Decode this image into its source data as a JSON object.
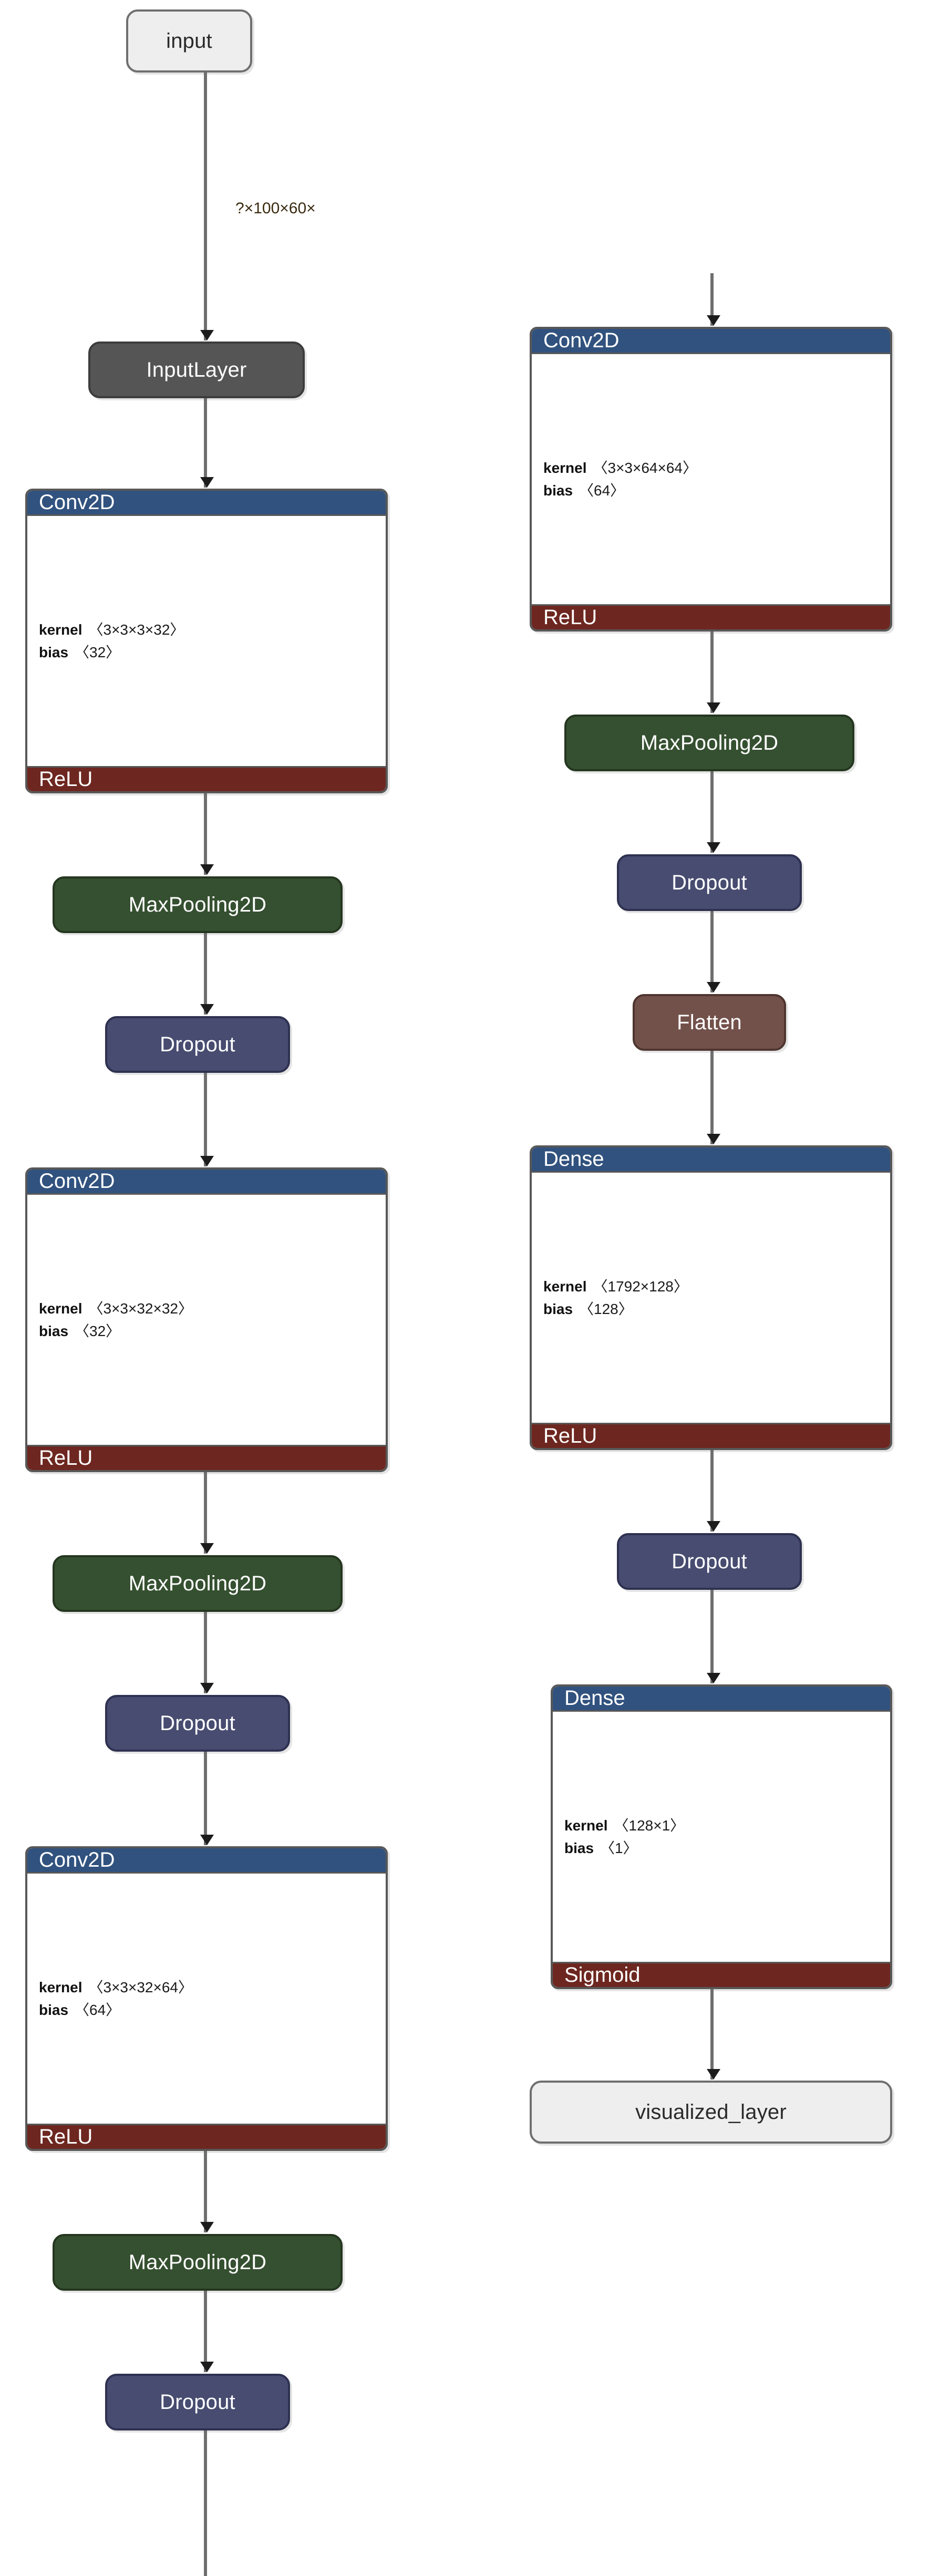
{
  "diagram": {
    "title": "visualized_layer model graph",
    "colors": {
      "layer_header": "#31527e",
      "activation": "#6d2720",
      "pooling": "#355030",
      "dropout": "#474c70",
      "flatten": "#73514b",
      "input_layer": "#555555",
      "io_node": "#eeeeee",
      "edge": "#6e6e6e",
      "border": "#4a4a4a",
      "params_bg": "#ffffff"
    }
  },
  "labels": {
    "kernel": "kernel",
    "bias": "bias"
  },
  "edge_labels": {
    "input_shape": "?×100×60×"
  },
  "nodes": {
    "input": {
      "label": "input",
      "kind": "io"
    },
    "input_layer": {
      "label": "InputLayer",
      "kind": "simple"
    },
    "conv1": {
      "title": "Conv2D",
      "kernel_shape": "〈3×3×3×32〉",
      "bias_shape": "〈32〉",
      "activation": "ReLU"
    },
    "pool1": {
      "label": "MaxPooling2D",
      "kind": "pool"
    },
    "drop1": {
      "label": "Dropout",
      "kind": "dropout"
    },
    "conv2": {
      "title": "Conv2D",
      "kernel_shape": "〈3×3×32×32〉",
      "bias_shape": "〈32〉",
      "activation": "ReLU"
    },
    "pool2": {
      "label": "MaxPooling2D",
      "kind": "pool"
    },
    "drop2": {
      "label": "Dropout",
      "kind": "dropout"
    },
    "conv3": {
      "title": "Conv2D",
      "kernel_shape": "〈3×3×32×64〉",
      "bias_shape": "〈64〉",
      "activation": "ReLU"
    },
    "pool3": {
      "label": "MaxPooling2D",
      "kind": "pool"
    },
    "drop3": {
      "label": "Dropout",
      "kind": "dropout"
    },
    "conv4": {
      "title": "Conv2D",
      "kernel_shape": "〈3×3×64×64〉",
      "bias_shape": "〈64〉",
      "activation": "ReLU"
    },
    "pool4": {
      "label": "MaxPooling2D",
      "kind": "pool"
    },
    "drop4": {
      "label": "Dropout",
      "kind": "dropout"
    },
    "flatten": {
      "label": "Flatten",
      "kind": "flatten"
    },
    "dense1": {
      "title": "Dense",
      "kernel_shape": "〈1792×128〉",
      "bias_shape": "〈128〉",
      "activation": "ReLU"
    },
    "drop5": {
      "label": "Dropout",
      "kind": "dropout"
    },
    "dense2": {
      "title": "Dense",
      "kernel_shape": "〈128×1〉",
      "bias_shape": "〈1〉",
      "activation": "Sigmoid"
    },
    "output": {
      "label": "visualized_layer",
      "kind": "io"
    }
  },
  "graph": {
    "left_column_order": [
      "input",
      "input_layer",
      "conv1",
      "pool1",
      "drop1",
      "conv2",
      "pool2",
      "drop2",
      "conv3",
      "pool3",
      "drop3"
    ],
    "right_column_order": [
      "conv4",
      "pool4",
      "drop4",
      "flatten",
      "dense1",
      "drop5",
      "dense2",
      "output"
    ]
  }
}
